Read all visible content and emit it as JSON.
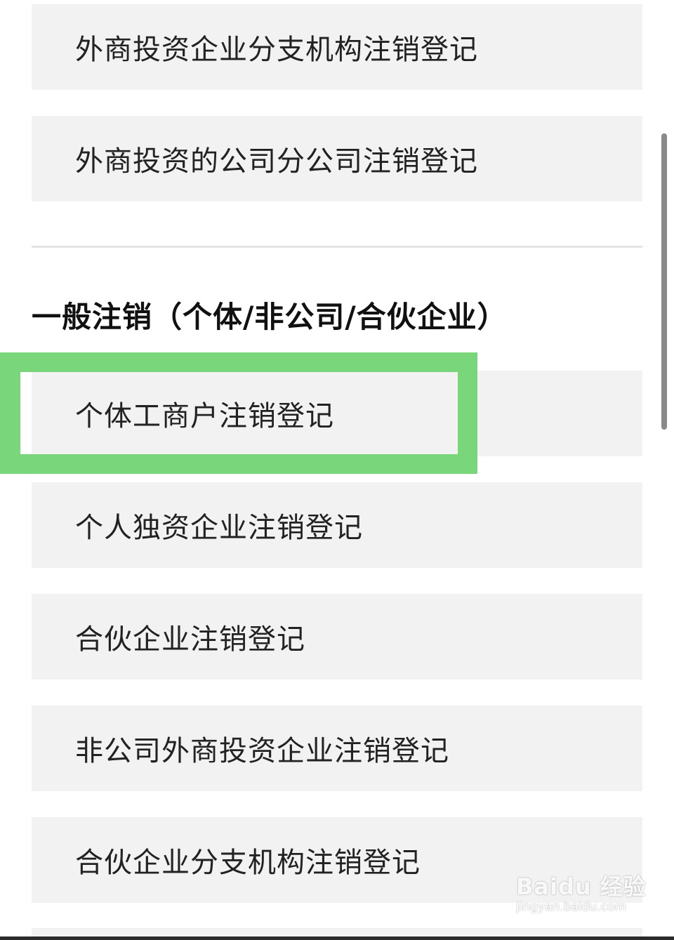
{
  "top_items": [
    {
      "label": "外商投资企业分支机构注销登记"
    },
    {
      "label": "外商投资的公司分公司注销登记"
    }
  ],
  "section": {
    "title": "一般注销（个体/非公司/合伙企业）",
    "items": [
      {
        "label": "个体工商户注销登记",
        "highlighted": true
      },
      {
        "label": "个人独资企业注销登记"
      },
      {
        "label": "合伙企业注销登记"
      },
      {
        "label": "非公司外商投资企业注销登记"
      },
      {
        "label": "合伙企业分支机构注销登记"
      }
    ]
  },
  "watermark": {
    "brand": "Baidu 经验",
    "url": "jingyan.baidu.com"
  },
  "colors": {
    "highlight": "#79d67a",
    "item_bg": "#f2f2f2",
    "divider": "#e4e4e4"
  }
}
